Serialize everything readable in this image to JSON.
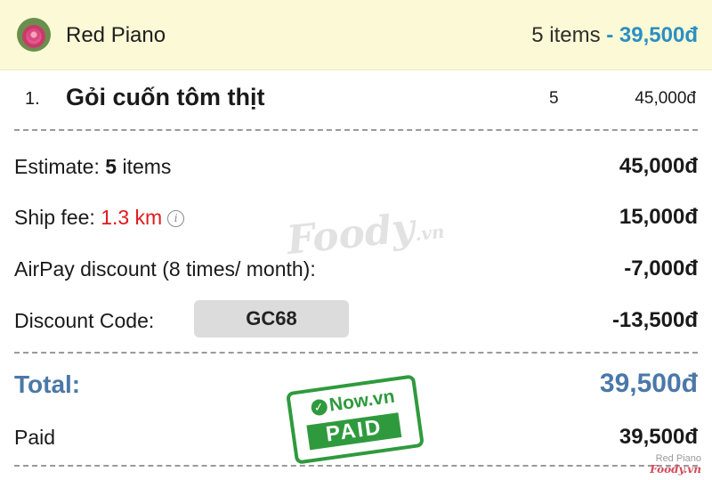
{
  "header": {
    "shop_name": "Red Piano",
    "items_count": "5 items",
    "separator": "-",
    "total": "39,500đ"
  },
  "order_items": [
    {
      "index": "1.",
      "name": "Gỏi cuốn tôm thịt",
      "quantity": "5",
      "price": "45,000đ"
    }
  ],
  "summary": {
    "estimate_label": "Estimate:",
    "estimate_count": "5",
    "estimate_unit": "items",
    "estimate_value": "45,000đ",
    "ship_label": "Ship fee:",
    "ship_distance": "1.3 km",
    "ship_info_icon": "info-icon",
    "ship_value": "15,000đ",
    "airpay_label": "AirPay discount (8 times/ month):",
    "airpay_value": "-7,000đ",
    "code_label": "Discount Code:",
    "code": "GC68",
    "code_value": "-13,500đ",
    "total_label": "Total:",
    "total_value": "39,500đ",
    "paid_label": "Paid",
    "paid_value": "39,500đ"
  },
  "watermark": {
    "brand": "Foody",
    "suffix": ".vn"
  },
  "stamp": {
    "top": "Now.vn",
    "bottom": "PAID"
  },
  "corner_mark": {
    "shop": "Red Piano",
    "brand": "Foody.vn"
  },
  "colors": {
    "header_bg": "#fbf9d6",
    "accent_blue": "#2b8fc4",
    "total_blue": "#4a78a8",
    "distance_red": "#e3191b",
    "stamp_green": "#2f9a3d"
  }
}
